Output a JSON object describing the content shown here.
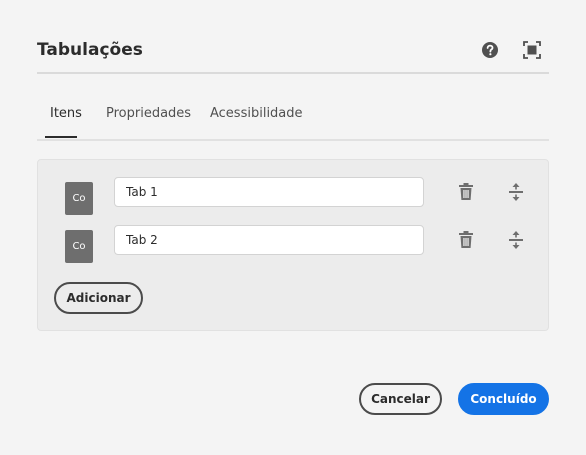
{
  "dialog": {
    "title": "Tabulações",
    "help_icon": "help-circle-icon",
    "fullscreen_icon": "fullscreen-icon"
  },
  "tabs": [
    {
      "label": "Itens",
      "active": true
    },
    {
      "label": "Propriedades",
      "active": false
    },
    {
      "label": "Acessibilidade",
      "active": false
    }
  ],
  "items": [
    {
      "thumb": "Co",
      "value": "Tab 1"
    },
    {
      "thumb": "Co",
      "value": "Tab 2"
    }
  ],
  "item_actions": {
    "delete_icon": "trash-icon",
    "reorder_icon": "drag-handle-icon"
  },
  "add_button": "Adicionar",
  "footer": {
    "cancel": "Cancelar",
    "done": "Concluído"
  },
  "colors": {
    "accent": "#1473e6",
    "background": "#f4f4f4",
    "thumb": "#6e6e6e"
  }
}
